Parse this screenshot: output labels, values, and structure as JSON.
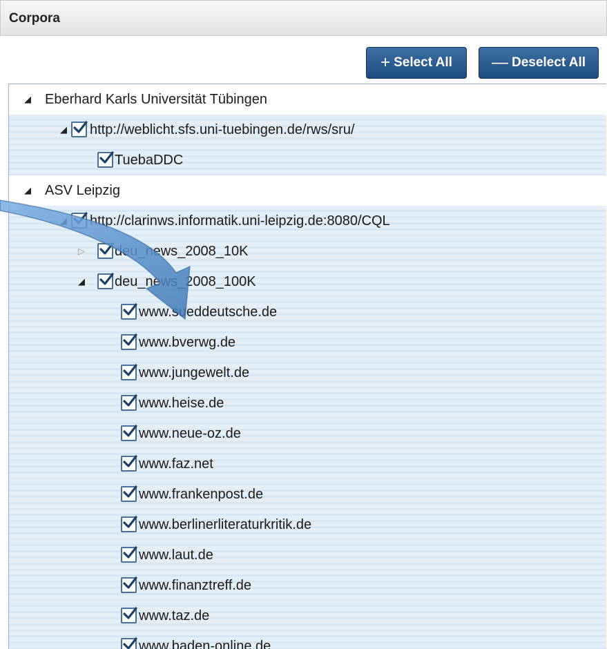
{
  "panel": {
    "title": "Corpora",
    "select_all": "Select All",
    "deselect_all": "Deselect All",
    "select_all_glyph": "+",
    "deselect_all_glyph": "—"
  },
  "tree": [
    {
      "label": "Eberhard Karls Universität Tübingen",
      "level": 0,
      "toggle": "expanded",
      "checkbox": false,
      "style": "white"
    },
    {
      "label": "http://weblicht.sfs.uni-tuebingen.de/rws/sru/",
      "level": 1,
      "toggle": "expanded",
      "checkbox": true,
      "style": "stripe"
    },
    {
      "label": "TuebaDDC",
      "level": 2,
      "toggle": "none",
      "checkbox": true,
      "style": "stripe"
    },
    {
      "label": "ASV Leipzig",
      "level": 0,
      "toggle": "expanded",
      "checkbox": false,
      "style": "white"
    },
    {
      "label": "http://clarinws.informatik.uni-leipzig.de:8080/CQL",
      "level": 1,
      "toggle": "expanded",
      "checkbox": true,
      "style": "stripe"
    },
    {
      "label": "deu_news_2008_10K",
      "level": 2,
      "toggle": "collapsed",
      "checkbox": true,
      "style": "stripe"
    },
    {
      "label": "deu_news_2008_100K",
      "level": 2,
      "toggle": "expanded",
      "checkbox": true,
      "style": "stripe"
    },
    {
      "label": "www.sueddeutsche.de",
      "level": 3,
      "toggle": "none",
      "checkbox": true,
      "style": "stripe"
    },
    {
      "label": "www.bverwg.de",
      "level": 3,
      "toggle": "none",
      "checkbox": true,
      "style": "stripe"
    },
    {
      "label": "www.jungewelt.de",
      "level": 3,
      "toggle": "none",
      "checkbox": true,
      "style": "stripe"
    },
    {
      "label": "www.heise.de",
      "level": 3,
      "toggle": "none",
      "checkbox": true,
      "style": "stripe"
    },
    {
      "label": "www.neue-oz.de",
      "level": 3,
      "toggle": "none",
      "checkbox": true,
      "style": "stripe"
    },
    {
      "label": "www.faz.net",
      "level": 3,
      "toggle": "none",
      "checkbox": true,
      "style": "stripe"
    },
    {
      "label": "www.frankenpost.de",
      "level": 3,
      "toggle": "none",
      "checkbox": true,
      "style": "stripe"
    },
    {
      "label": "www.berlinerliteraturkritik.de",
      "level": 3,
      "toggle": "none",
      "checkbox": true,
      "style": "stripe"
    },
    {
      "label": "www.laut.de",
      "level": 3,
      "toggle": "none",
      "checkbox": true,
      "style": "stripe"
    },
    {
      "label": "www.finanztreff.de",
      "level": 3,
      "toggle": "none",
      "checkbox": true,
      "style": "stripe"
    },
    {
      "label": "www.taz.de",
      "level": 3,
      "toggle": "none",
      "checkbox": true,
      "style": "stripe"
    },
    {
      "label": "www.baden-online.de",
      "level": 3,
      "toggle": "none",
      "checkbox": true,
      "style": "stripe"
    }
  ],
  "icons": {
    "expanded": "triangle-expanded-icon",
    "collapsed": "triangle-collapsed-icon",
    "checked": "checkbox-checked-icon",
    "overlay": "curved-arrow-overlay-icon"
  },
  "colors": {
    "button": "#2a5b8e",
    "row_stripe": "#e4eff8",
    "arrow": "#4f88c4"
  }
}
